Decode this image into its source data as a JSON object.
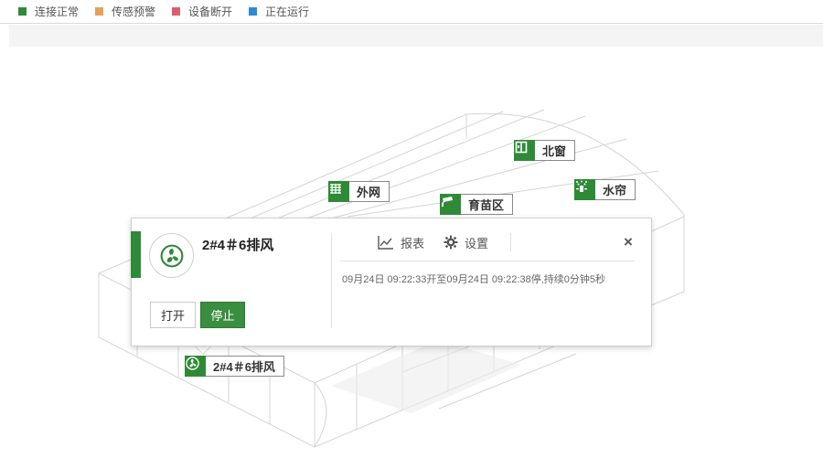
{
  "legend": [
    {
      "label": "连接正常",
      "color": "#2f8a37"
    },
    {
      "label": "传感预警",
      "color": "#e3a25a"
    },
    {
      "label": "设备断开",
      "color": "#d9606a"
    },
    {
      "label": "正在运行",
      "color": "#2d8bd4"
    }
  ],
  "devices": {
    "north_window": {
      "label": "北窗",
      "icon": "window-icon"
    },
    "outer_net": {
      "label": "外网",
      "icon": "net-icon"
    },
    "nursery": {
      "label": "育苗区",
      "icon": "camera-icon"
    },
    "water_curtain": {
      "label": "水帘",
      "icon": "sprinkler-icon"
    },
    "exhaust_fan": {
      "label": "2#4＃6排风",
      "icon": "fan-icon"
    }
  },
  "popup": {
    "title": "2#4＃6排风",
    "icon": "fan-icon",
    "open_label": "打开",
    "stop_label": "停止",
    "report_label": "报表",
    "settings_label": "设置",
    "close_label": "×",
    "log_text": "09月24日 09:22:33开至09月24日 09:22:38停,持续0分钟5秒"
  },
  "colors": {
    "accent": "#2f8a37",
    "stop_button": "#3a8e3f"
  }
}
